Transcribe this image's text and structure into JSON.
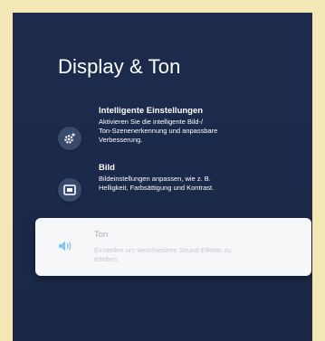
{
  "page": {
    "title": "Display & Ton"
  },
  "menu": {
    "items": [
      {
        "id": "smart-settings",
        "title": "Intelligente Einstellungen",
        "description": "Aktivieren Sie die intelligente Bild-/\nTon-Szenenerkennung und anpassbare\nVerbesserung.",
        "icon": "gear-sparkle-icon",
        "focused": false
      },
      {
        "id": "picture",
        "title": "Bild",
        "description": "Bildeinstellungen anpassen, wie z. B.\nHelligkeit, Farbsättigung und Kontrast.",
        "icon": "picture-icon",
        "focused": false
      },
      {
        "id": "sound",
        "title": "Ton",
        "description": "Einstellen um verschiedene Sound-Effekte zu\nerleben.",
        "icon": "speaker-icon",
        "focused": true
      }
    ]
  },
  "colors": {
    "background": "#1b2a4a",
    "focus_card": "#f6f7f9",
    "accent_icon": "#7fc6f2",
    "text_primary": "#ffffff",
    "text_focused": "#a7adb9"
  }
}
